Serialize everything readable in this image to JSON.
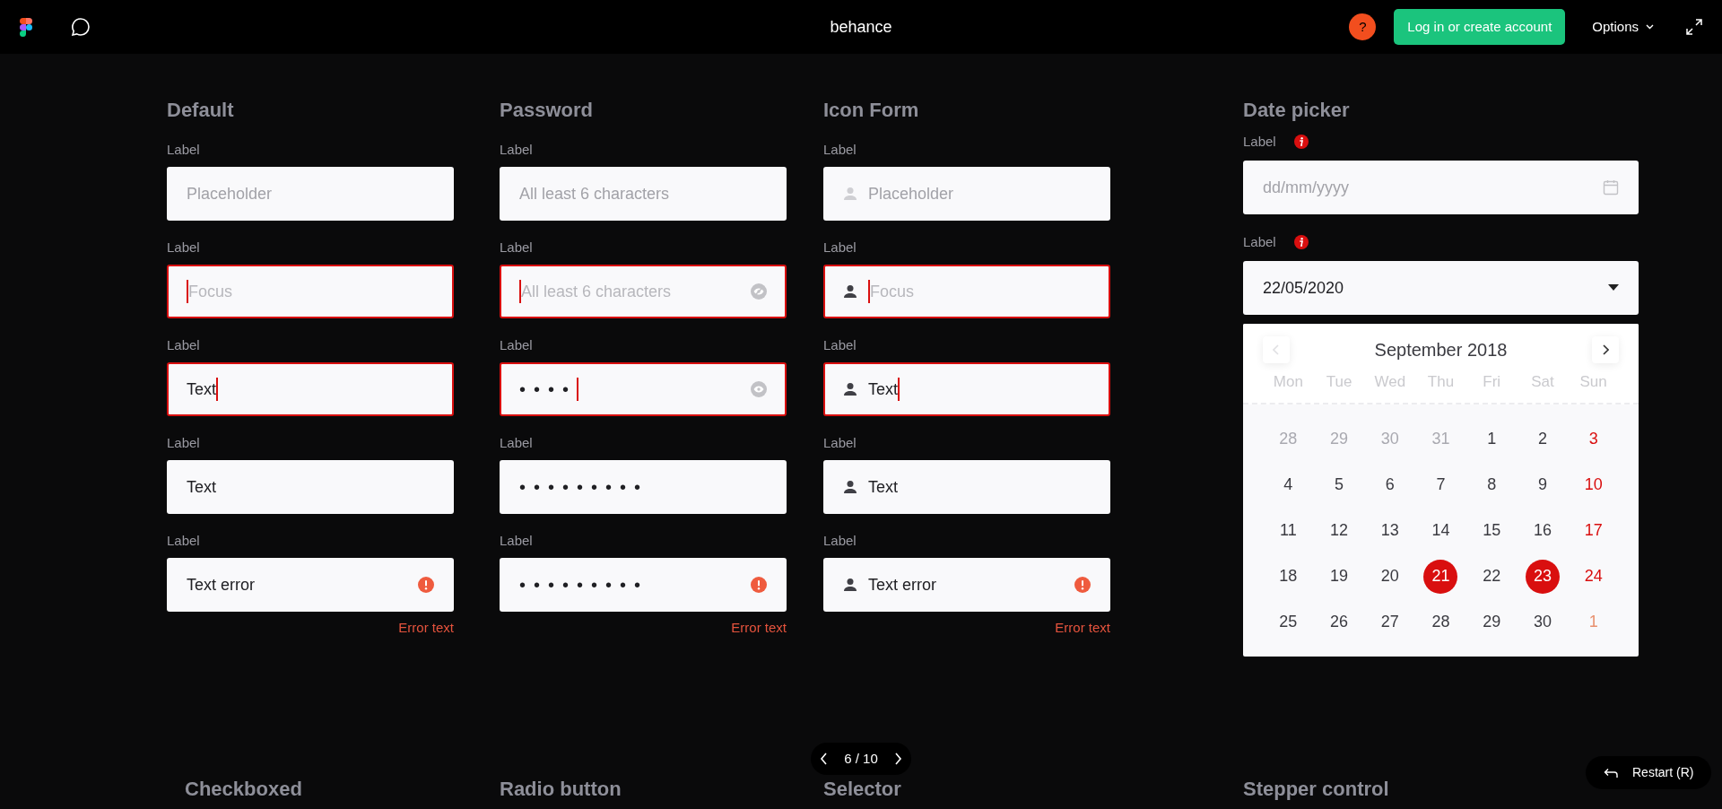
{
  "topbar": {
    "title": "behance",
    "help": "?",
    "login_button": "Log in or create account",
    "options": "Options"
  },
  "columns": [
    {
      "title": "Default",
      "fields": [
        {
          "label": "Label",
          "placeholder": "Placeholder",
          "focused": false,
          "kind": "plain"
        },
        {
          "label": "Label",
          "placeholder": "Focus",
          "focused": true,
          "kind": "plain"
        },
        {
          "label": "Label",
          "value": "Text",
          "focused": true,
          "kind": "plain"
        },
        {
          "label": "Label",
          "value": "Text",
          "focused": false,
          "kind": "plain"
        },
        {
          "label": "Label",
          "value": "Text error",
          "focused": false,
          "kind": "error",
          "error_text": "Error text"
        }
      ]
    },
    {
      "title": "Password",
      "fields": [
        {
          "label": "Label",
          "placeholder": "All least 6 characters",
          "focused": false,
          "kind": "plain"
        },
        {
          "label": "Label",
          "placeholder": "All least 6 characters",
          "focused": true,
          "kind": "toggle-hidden"
        },
        {
          "label": "Label",
          "value": "••••",
          "focused": true,
          "kind": "toggle-shown"
        },
        {
          "label": "Label",
          "value": "•••••••••",
          "focused": false,
          "kind": "masked"
        },
        {
          "label": "Label",
          "value": "•••••••••",
          "focused": false,
          "kind": "masked-error",
          "error_text": "Error text"
        }
      ]
    },
    {
      "title": "Icon Form",
      "fields": [
        {
          "label": "Label",
          "placeholder": "Placeholder",
          "focused": false,
          "kind": "icon"
        },
        {
          "label": "Label",
          "placeholder": "Focus",
          "focused": true,
          "kind": "icon"
        },
        {
          "label": "Label",
          "value": "Text",
          "focused": true,
          "kind": "icon"
        },
        {
          "label": "Label",
          "value": "Text",
          "focused": false,
          "kind": "icon"
        },
        {
          "label": "Label",
          "value": "Text error",
          "focused": false,
          "kind": "icon-error",
          "error_text": "Error text"
        }
      ]
    }
  ],
  "date_picker": {
    "title": "Date picker",
    "fields": [
      {
        "label": "Label",
        "info": true,
        "placeholder": "dd/mm/yyyy",
        "kind": "date"
      },
      {
        "label": "Label",
        "info": true,
        "value": "22/05/2020",
        "kind": "select"
      }
    ],
    "calendar": {
      "month": "September 2018",
      "prev_disabled": true,
      "weekdays": [
        "Mon",
        "Tue",
        "Wed",
        "Thu",
        "Fri",
        "Sat",
        "Sun"
      ],
      "weeks": [
        [
          {
            "text": "28",
            "kind": "outside",
            "selected": false
          },
          {
            "text": "29",
            "kind": "outside",
            "selected": false
          },
          {
            "text": "30",
            "kind": "outside",
            "selected": false
          },
          {
            "text": "31",
            "kind": "outside",
            "selected": false
          },
          {
            "text": "1",
            "kind": "day",
            "selected": false
          },
          {
            "text": "2",
            "kind": "day",
            "selected": false
          },
          {
            "text": "3",
            "kind": "weekend",
            "selected": false
          }
        ],
        [
          {
            "text": "4",
            "kind": "day",
            "selected": false
          },
          {
            "text": "5",
            "kind": "day",
            "selected": false
          },
          {
            "text": "6",
            "kind": "day",
            "selected": false
          },
          {
            "text": "7",
            "kind": "day",
            "selected": false
          },
          {
            "text": "8",
            "kind": "day",
            "selected": false
          },
          {
            "text": "9",
            "kind": "day",
            "selected": false
          },
          {
            "text": "10",
            "kind": "weekend",
            "selected": false
          }
        ],
        [
          {
            "text": "11",
            "kind": "day",
            "selected": false
          },
          {
            "text": "12",
            "kind": "day",
            "selected": false
          },
          {
            "text": "13",
            "kind": "day",
            "selected": false
          },
          {
            "text": "14",
            "kind": "day",
            "selected": false
          },
          {
            "text": "15",
            "kind": "day",
            "selected": false
          },
          {
            "text": "16",
            "kind": "day",
            "selected": false
          },
          {
            "text": "17",
            "kind": "weekend",
            "selected": false
          }
        ],
        [
          {
            "text": "18",
            "kind": "day",
            "selected": false
          },
          {
            "text": "19",
            "kind": "day",
            "selected": false
          },
          {
            "text": "20",
            "kind": "day",
            "selected": false
          },
          {
            "text": "21",
            "kind": "day",
            "selected": true
          },
          {
            "text": "22",
            "kind": "day",
            "selected": false
          },
          {
            "text": "23",
            "kind": "day",
            "selected": true
          },
          {
            "text": "24",
            "kind": "weekend",
            "selected": false
          }
        ],
        [
          {
            "text": "25",
            "kind": "day",
            "selected": false
          },
          {
            "text": "26",
            "kind": "day",
            "selected": false
          },
          {
            "text": "27",
            "kind": "day",
            "selected": false
          },
          {
            "text": "28",
            "kind": "day",
            "selected": false
          },
          {
            "text": "29",
            "kind": "day",
            "selected": false
          },
          {
            "text": "30",
            "kind": "day",
            "selected": false
          },
          {
            "text": "1",
            "kind": "outside-weekend",
            "selected": false
          }
        ]
      ]
    }
  },
  "next_section_titles": [
    "Checkboxed",
    "Radio button",
    "Selector",
    "Stepper control"
  ],
  "pager": {
    "text": "6 / 10"
  },
  "restart_button": "Restart (R)"
}
